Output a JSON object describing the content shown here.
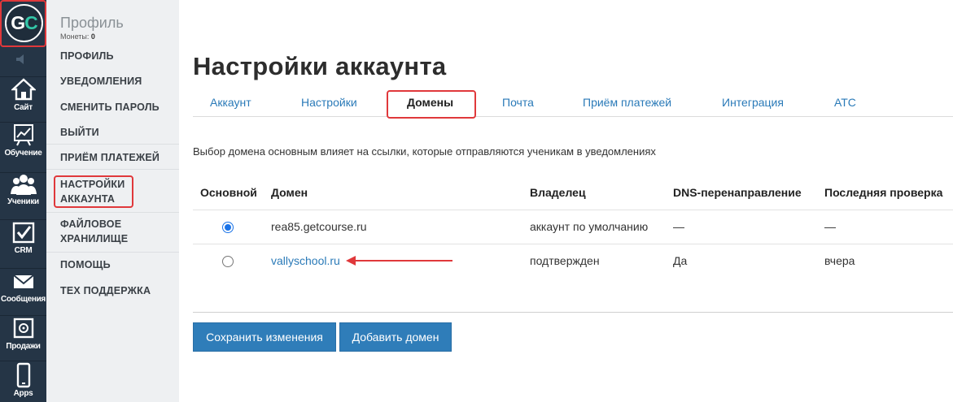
{
  "logo": {
    "text_g": "G",
    "text_c": "C"
  },
  "rail": {
    "items": [
      {
        "label": "Сайт",
        "icon": "house-icon"
      },
      {
        "label": "Обучение",
        "icon": "chart-board-icon"
      },
      {
        "label": "Ученики",
        "icon": "users-icon"
      },
      {
        "label": "CRM",
        "icon": "checkbox-icon"
      },
      {
        "label": "Сообщения",
        "icon": "envelope-icon"
      },
      {
        "label": "Продажи",
        "icon": "safe-icon"
      },
      {
        "label": "Apps",
        "icon": "phone-icon"
      }
    ]
  },
  "menu": {
    "title": "Профиль",
    "coins_label": "Монеты:",
    "coins_value": "0",
    "items": [
      "ПРОФИЛЬ",
      "УВЕДОМЛЕНИЯ",
      "СМЕНИТЬ ПАРОЛЬ",
      "ВЫЙТИ",
      "ПРИЁМ ПЛАТЕЖЕЙ",
      "НАСТРОЙКИ АККАУНТА",
      "ФАЙЛОВОЕ ХРАНИЛИЩЕ",
      "ПОМОЩЬ",
      "ТЕХ ПОДДЕРЖКА"
    ]
  },
  "page": {
    "title": "Настройки аккаунта",
    "tabs": [
      "Аккаунт",
      "Настройки",
      "Домены",
      "Почта",
      "Приём платежей",
      "Интеграция",
      "АТС"
    ],
    "active_tab": "Домены",
    "description": "Выбор домена основным влияет на ссылки, которые отправляются ученикам в уведомлениях"
  },
  "table": {
    "headers": [
      "Основной",
      "Домен",
      "Владелец",
      "DNS-перенаправление",
      "Последняя проверка"
    ],
    "rows": [
      {
        "primary": true,
        "domain": "rea85.getcourse.ru",
        "owner": "аккаунт по умолчанию",
        "dns": "—",
        "last_check": "—"
      },
      {
        "primary": false,
        "domain": "vallyschool.ru",
        "owner": "подтвержден",
        "dns": "Да",
        "last_check": "вчера"
      }
    ]
  },
  "buttons": {
    "save": "Сохранить изменения",
    "add_domain": "Добавить домен"
  },
  "colors": {
    "accent": "#2f7db9",
    "highlight": "#e0383b",
    "rail": "#253546",
    "link": "#2a7ab8"
  }
}
